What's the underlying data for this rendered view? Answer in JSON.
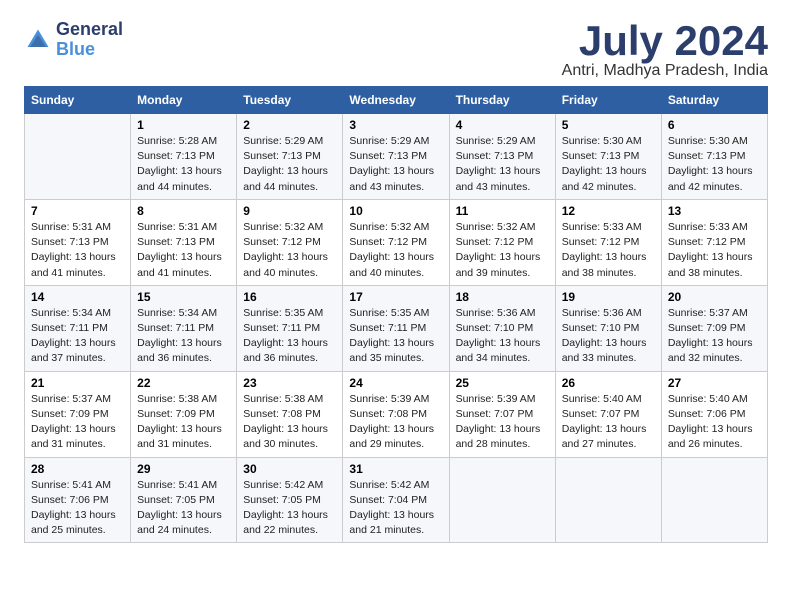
{
  "logo": {
    "general": "General",
    "blue": "Blue"
  },
  "title": "July 2024",
  "subtitle": "Antri, Madhya Pradesh, India",
  "days_of_week": [
    "Sunday",
    "Monday",
    "Tuesday",
    "Wednesday",
    "Thursday",
    "Friday",
    "Saturday"
  ],
  "weeks": [
    [
      {
        "day": "",
        "info": ""
      },
      {
        "day": "1",
        "info": "Sunrise: 5:28 AM\nSunset: 7:13 PM\nDaylight: 13 hours\nand 44 minutes."
      },
      {
        "day": "2",
        "info": "Sunrise: 5:29 AM\nSunset: 7:13 PM\nDaylight: 13 hours\nand 44 minutes."
      },
      {
        "day": "3",
        "info": "Sunrise: 5:29 AM\nSunset: 7:13 PM\nDaylight: 13 hours\nand 43 minutes."
      },
      {
        "day": "4",
        "info": "Sunrise: 5:29 AM\nSunset: 7:13 PM\nDaylight: 13 hours\nand 43 minutes."
      },
      {
        "day": "5",
        "info": "Sunrise: 5:30 AM\nSunset: 7:13 PM\nDaylight: 13 hours\nand 42 minutes."
      },
      {
        "day": "6",
        "info": "Sunrise: 5:30 AM\nSunset: 7:13 PM\nDaylight: 13 hours\nand 42 minutes."
      }
    ],
    [
      {
        "day": "7",
        "info": "Sunrise: 5:31 AM\nSunset: 7:13 PM\nDaylight: 13 hours\nand 41 minutes."
      },
      {
        "day": "8",
        "info": "Sunrise: 5:31 AM\nSunset: 7:13 PM\nDaylight: 13 hours\nand 41 minutes."
      },
      {
        "day": "9",
        "info": "Sunrise: 5:32 AM\nSunset: 7:12 PM\nDaylight: 13 hours\nand 40 minutes."
      },
      {
        "day": "10",
        "info": "Sunrise: 5:32 AM\nSunset: 7:12 PM\nDaylight: 13 hours\nand 40 minutes."
      },
      {
        "day": "11",
        "info": "Sunrise: 5:32 AM\nSunset: 7:12 PM\nDaylight: 13 hours\nand 39 minutes."
      },
      {
        "day": "12",
        "info": "Sunrise: 5:33 AM\nSunset: 7:12 PM\nDaylight: 13 hours\nand 38 minutes."
      },
      {
        "day": "13",
        "info": "Sunrise: 5:33 AM\nSunset: 7:12 PM\nDaylight: 13 hours\nand 38 minutes."
      }
    ],
    [
      {
        "day": "14",
        "info": "Sunrise: 5:34 AM\nSunset: 7:11 PM\nDaylight: 13 hours\nand 37 minutes."
      },
      {
        "day": "15",
        "info": "Sunrise: 5:34 AM\nSunset: 7:11 PM\nDaylight: 13 hours\nand 36 minutes."
      },
      {
        "day": "16",
        "info": "Sunrise: 5:35 AM\nSunset: 7:11 PM\nDaylight: 13 hours\nand 36 minutes."
      },
      {
        "day": "17",
        "info": "Sunrise: 5:35 AM\nSunset: 7:11 PM\nDaylight: 13 hours\nand 35 minutes."
      },
      {
        "day": "18",
        "info": "Sunrise: 5:36 AM\nSunset: 7:10 PM\nDaylight: 13 hours\nand 34 minutes."
      },
      {
        "day": "19",
        "info": "Sunrise: 5:36 AM\nSunset: 7:10 PM\nDaylight: 13 hours\nand 33 minutes."
      },
      {
        "day": "20",
        "info": "Sunrise: 5:37 AM\nSunset: 7:09 PM\nDaylight: 13 hours\nand 32 minutes."
      }
    ],
    [
      {
        "day": "21",
        "info": "Sunrise: 5:37 AM\nSunset: 7:09 PM\nDaylight: 13 hours\nand 31 minutes."
      },
      {
        "day": "22",
        "info": "Sunrise: 5:38 AM\nSunset: 7:09 PM\nDaylight: 13 hours\nand 31 minutes."
      },
      {
        "day": "23",
        "info": "Sunrise: 5:38 AM\nSunset: 7:08 PM\nDaylight: 13 hours\nand 30 minutes."
      },
      {
        "day": "24",
        "info": "Sunrise: 5:39 AM\nSunset: 7:08 PM\nDaylight: 13 hours\nand 29 minutes."
      },
      {
        "day": "25",
        "info": "Sunrise: 5:39 AM\nSunset: 7:07 PM\nDaylight: 13 hours\nand 28 minutes."
      },
      {
        "day": "26",
        "info": "Sunrise: 5:40 AM\nSunset: 7:07 PM\nDaylight: 13 hours\nand 27 minutes."
      },
      {
        "day": "27",
        "info": "Sunrise: 5:40 AM\nSunset: 7:06 PM\nDaylight: 13 hours\nand 26 minutes."
      }
    ],
    [
      {
        "day": "28",
        "info": "Sunrise: 5:41 AM\nSunset: 7:06 PM\nDaylight: 13 hours\nand 25 minutes."
      },
      {
        "day": "29",
        "info": "Sunrise: 5:41 AM\nSunset: 7:05 PM\nDaylight: 13 hours\nand 24 minutes."
      },
      {
        "day": "30",
        "info": "Sunrise: 5:42 AM\nSunset: 7:05 PM\nDaylight: 13 hours\nand 22 minutes."
      },
      {
        "day": "31",
        "info": "Sunrise: 5:42 AM\nSunset: 7:04 PM\nDaylight: 13 hours\nand 21 minutes."
      },
      {
        "day": "",
        "info": ""
      },
      {
        "day": "",
        "info": ""
      },
      {
        "day": "",
        "info": ""
      }
    ]
  ]
}
